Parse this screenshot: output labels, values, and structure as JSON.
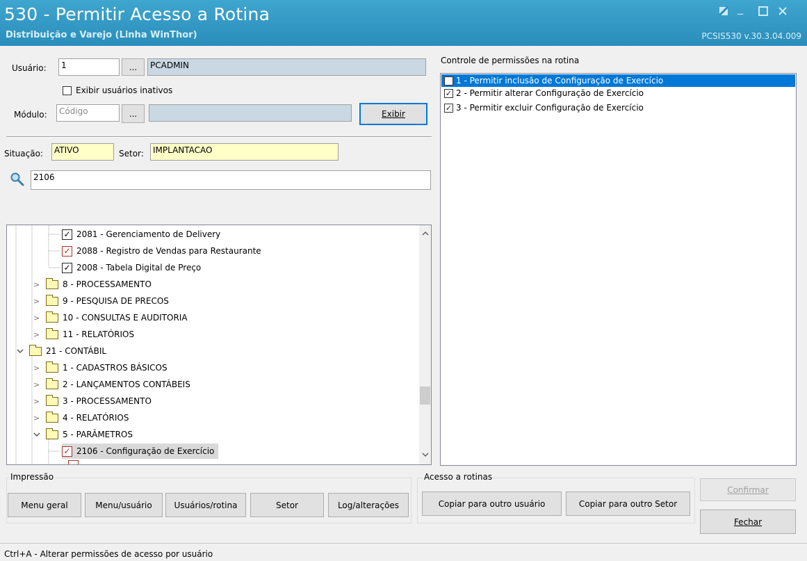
{
  "window": {
    "title": "530 - Permitir Acesso a Rotina",
    "subtitle": "Distribuição e Varejo (Linha WinThor)",
    "version": "PCSIS530  v.30.3.04.009"
  },
  "user": {
    "label": "Usuário:",
    "code": "1",
    "browse_label": "...",
    "name": "PCADMIN",
    "show_inactive_label": "Exibir usuários inativos"
  },
  "module": {
    "label": "Módulo:",
    "code_placeholder": "Código",
    "browse_label": "...",
    "name": "",
    "show_button": "Exibir"
  },
  "situation": {
    "label": "Situação:",
    "value": "ATIVO"
  },
  "sector": {
    "label": "Setor:",
    "value": "IMPLANTACAO"
  },
  "search": {
    "value": "2106"
  },
  "tree": {
    "items": [
      {
        "label": "2081 - Gerenciamento de Delivery",
        "kind": "check",
        "checked": true
      },
      {
        "label": "2088 - Registro de Vendas para Restaurante",
        "kind": "check",
        "checked": true
      },
      {
        "label": "2008 - Tabela Digital de Preço",
        "kind": "check",
        "checked": true
      },
      {
        "label": "8 - PROCESSAMENTO",
        "kind": "folder"
      },
      {
        "label": "9 - PESQUISA DE PRECOS",
        "kind": "folder"
      },
      {
        "label": "10 - CONSULTAS E AUDITORIA",
        "kind": "folder"
      },
      {
        "label": "11 - RELATÓRIOS",
        "kind": "folder"
      },
      {
        "label": "21 - CONTÁBIL",
        "kind": "folder",
        "expanded": true
      },
      {
        "label": "1 - CADASTROS BÁSICOS",
        "kind": "folder"
      },
      {
        "label": "2 - LANÇAMENTOS CONTÁBEIS",
        "kind": "folder"
      },
      {
        "label": "3 - PROCESSAMENTO",
        "kind": "folder"
      },
      {
        "label": "4 - RELATÓRIOS",
        "kind": "folder"
      },
      {
        "label": "5 - PARÂMETROS",
        "kind": "folder",
        "expanded": true
      },
      {
        "label": "2106 - Configuração de Exercício",
        "kind": "check",
        "checked": true,
        "selected": true
      }
    ]
  },
  "permissions": {
    "title": "Controle de permissões na rotina",
    "items": [
      {
        "label": "1 - Permitir inclusão de Configuração de Exercício",
        "checked": false,
        "selected": true
      },
      {
        "label": "2 - Permitir alterar Configuração de Exercício",
        "checked": true
      },
      {
        "label": "3 - Permitir excluir Configuração de Exercício",
        "checked": true
      }
    ]
  },
  "print_group": {
    "title": "Impressão",
    "buttons": [
      "Menu geral",
      "Menu/usuário",
      "Usuários/rotina",
      "Setor",
      "Log/alterações"
    ]
  },
  "access_group": {
    "title": "Acesso a rotinas",
    "buttons": [
      "Copiar para outro usuário",
      "Copiar para outro Setor"
    ]
  },
  "actions": {
    "confirm": "Confirmar",
    "close": "Fechar"
  },
  "status_bar": "Ctrl+A - Alterar permissões de acesso por usuário",
  "colors": {
    "title_bar": "#2a8dba",
    "selection": "#0078d7",
    "readonly_field": "#c9d8e2",
    "highlight_field": "#ffffc8"
  },
  "glyphs": {
    "check": "✓",
    "expanded": "⌄",
    "collapsed": "›",
    "scroll_up": "⌃",
    "scroll_down": "⌄"
  }
}
